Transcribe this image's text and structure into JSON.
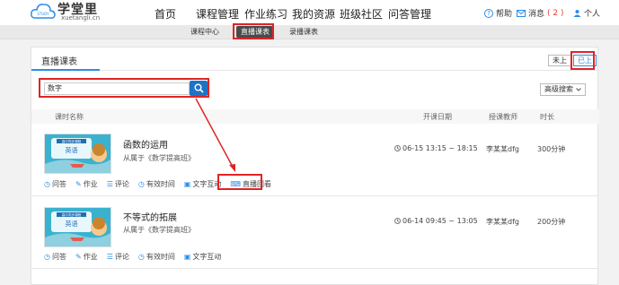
{
  "logo": {
    "title": "学堂里",
    "subtitle": "xuetangli.cn",
    "badge": "STUDY"
  },
  "nav": {
    "items": [
      {
        "label": "首页"
      },
      {
        "label": "课程管理"
      },
      {
        "label": "作业练习"
      },
      {
        "label": "我的资源"
      },
      {
        "label": "班级社区"
      },
      {
        "label": "问答管理"
      }
    ],
    "help": "帮助",
    "msg": "消息",
    "msg_count": "( 2 )",
    "me": "个人"
  },
  "subnav": {
    "items": [
      {
        "label": "课程中心"
      },
      {
        "label": "直播课表"
      },
      {
        "label": "录播课表"
      }
    ]
  },
  "panel": {
    "title": "直播课表",
    "tab_pending": "未上",
    "tab_done": "已上",
    "search_value": "数字",
    "adv_search": "高级搜索"
  },
  "table": {
    "headers": {
      "name": "课时名称",
      "date": "开课日期",
      "teacher": "授课教师",
      "duration": "时长"
    }
  },
  "courses": [
    {
      "title": "函数的运用",
      "belong": "从属于《数学提高班》",
      "time": "06-15 13:15 ~ 18:15",
      "teacher": "李某某dfg",
      "duration": "300分钟",
      "thumb_top": "高中同步课程",
      "thumb_main": "英语",
      "actions": [
        "问答",
        "作业",
        "评论",
        "有效时间",
        "文字互动",
        "直播回看"
      ]
    },
    {
      "title": "不等式的拓展",
      "belong": "从属于《数学提高班》",
      "time": "06-14 09:45 ~ 13:05",
      "teacher": "李某某dfg",
      "duration": "200分钟",
      "thumb_top": "高中同步课程",
      "thumb_main": "英语",
      "actions": [
        "问答",
        "作业",
        "评论",
        "有效时间",
        "文字互动"
      ]
    }
  ],
  "colors": {
    "accent": "#2a8de8",
    "highlight": "#e02424",
    "search_button": "#1e73c7"
  }
}
